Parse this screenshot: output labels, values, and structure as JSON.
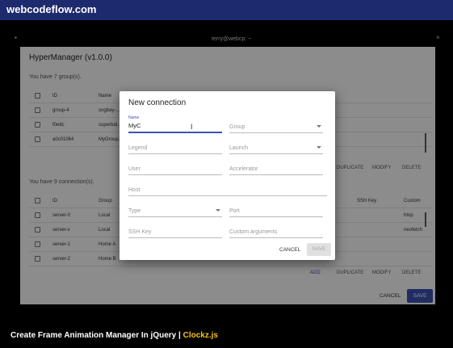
{
  "site": {
    "brand": "webcodeflow.com"
  },
  "window": {
    "title": "terry@webcp: ~",
    "controls": [
      "–",
      "□",
      "×"
    ]
  },
  "app": {
    "title": "HyperManager (v1.0.0)",
    "groups_caption": "You have 7 group(s).",
    "groups_headers": {
      "id": "ID",
      "name": "Name"
    },
    "groups_rows": [
      {
        "id": "group-4",
        "name": "sngbay-..."
      },
      {
        "id": "f0e8c",
        "name": "superbat..."
      },
      {
        "id": "a0c01064",
        "name": "MyGroup..."
      }
    ],
    "groups_actions": {
      "duplicate": "Duplicate",
      "modify": "Modify",
      "delete": "Delete"
    },
    "connections_caption": "You have 9 connection(s).",
    "connections_headers": {
      "id": "ID",
      "group": "Group",
      "ssh_key": "SSH Key",
      "custom": "Custom"
    },
    "connections_rows": [
      {
        "id": "server-0",
        "group": "Local",
        "custom": "htop"
      },
      {
        "id": "server-x",
        "group": "Local",
        "custom": "neofetch"
      },
      {
        "id": "server-1",
        "group": "Home A",
        "custom": ""
      },
      {
        "id": "server-2",
        "group": "Home B",
        "custom": ""
      }
    ],
    "connections_actions": {
      "add": "Add",
      "duplicate": "Duplicate",
      "modify": "Modify",
      "delete": "Delete"
    },
    "bottom": {
      "cancel": "Cancel",
      "save": "Save"
    }
  },
  "dialog": {
    "title": "New connection",
    "name_label": "Name",
    "name_value": "MyC",
    "placeholders": {
      "group": "Group",
      "legend": "Legend",
      "launch": "Launch",
      "user": "User",
      "accelerator": "Accelerator",
      "host": "Host",
      "type": "Type",
      "port": "Port",
      "ssh_key": "SSH Key",
      "custom_arguments": "Custom arguments"
    },
    "cancel": "Cancel",
    "save": "Save"
  },
  "footer": {
    "text": "Create Frame Animation Manager In jQuery | ",
    "highlight": "Clockz.js"
  },
  "colors": {
    "topbar": "#1e2a6e",
    "accent": "#3f51b5",
    "highlight": "#f5c518"
  }
}
